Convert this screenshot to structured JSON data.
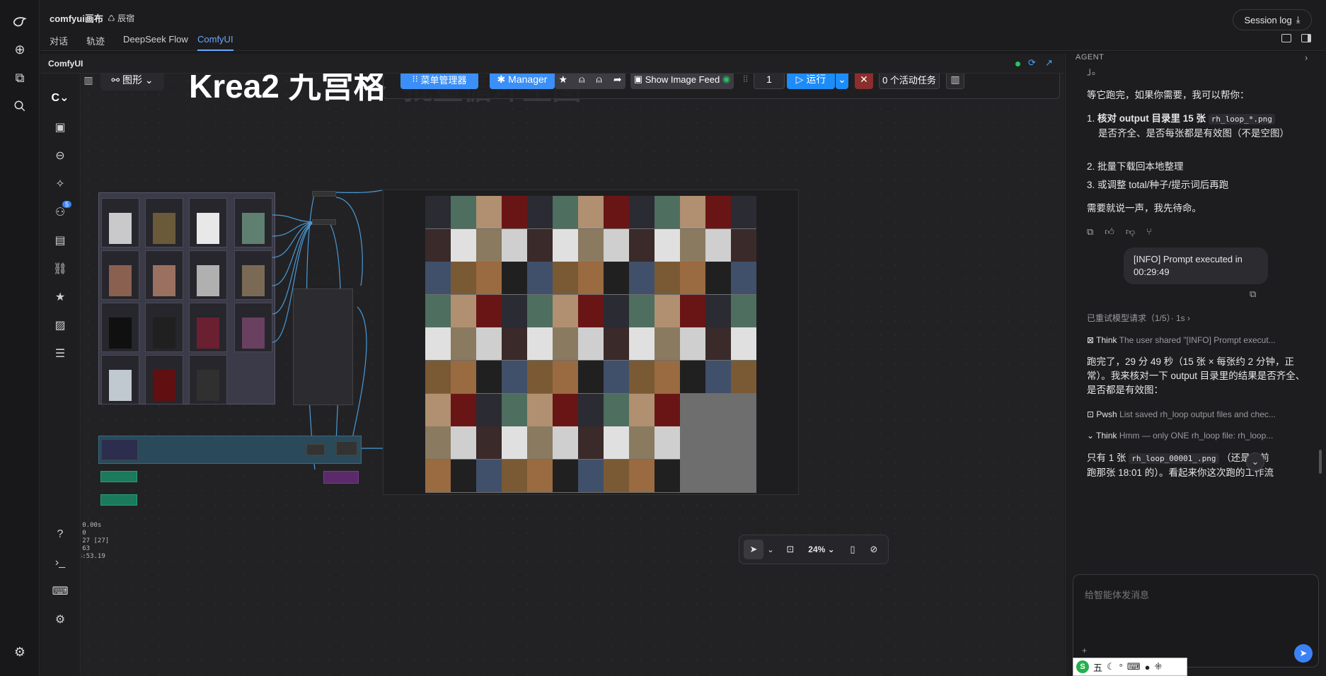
{
  "window": {
    "title": "comfyui画布",
    "workspace": "辰宿"
  },
  "tabs": [
    {
      "label": "对话"
    },
    {
      "label": "轨迹"
    },
    {
      "label": "DeepSeek Flow"
    },
    {
      "label": "ComfyUI"
    }
  ],
  "session_log": {
    "label": "Session log"
  },
  "panel": {
    "title": "ComfyUI"
  },
  "sidebar": {
    "badge": "5"
  },
  "toolbar": {
    "graph_label": "图形",
    "workflow_title": "Krea2 九宫格",
    "menu_manager": "菜单管理器",
    "manager": "Manager",
    "image_feed": "Show Image Feed",
    "batch_count": "1",
    "run": "运行",
    "active_tasks": "0 个活动任务",
    "overlay_title": "批量循环生图"
  },
  "stats": {
    "t": "T: 0.00s",
    "i": "I: 0",
    "n": "N: 27 [27]",
    "v": "V: 63",
    "fps": "FPS:53.19"
  },
  "canvas_controls": {
    "zoom": "24%"
  },
  "agent": {
    "header": "AGENT",
    "fragment": "」。",
    "intro": "等它跑完，如果你需要，我可以帮你：",
    "items": [
      {
        "bold": "核对 output 目录里 15 张",
        "code": "rh_loop_*.png",
        "rest": "是否齐全、是否每张都是有效图（不是空图）"
      },
      {
        "text": "批量下载回本地整理"
      },
      {
        "text": "或调整 total/种子/提示词后再跑"
      }
    ],
    "closing": "需要就说一声，我先待命。",
    "user_msg": "[INFO] Prompt executed in 00:29:49",
    "retry": "已重试模型请求（1/5）· 1s",
    "think1_label": "Think",
    "think1_text": "The user shared \"[INFO] Prompt execut...",
    "reply": "跑完了，29 分 49 秒（15 张 × 每张约 2 分钟，正常）。我来核对一下 output 目录里的结果是否齐全、是否都是有效图：",
    "pwsh_label": "Pwsh",
    "pwsh_text": "List saved rh_loop output files and chec...",
    "think2_label": "Think",
    "think2_text": "Hmm — only ONE rh_loop file: rh_loop...",
    "last_prefix": "只有 1 张",
    "last_code": "rh_loop_00001_.png",
    "last_suffix": "（还是之前",
    "last_line2": "跑那张 18:01 的）。看起来你这次跑的工作流",
    "input_placeholder": "给智能体发消息"
  },
  "ime": {
    "label": "五"
  },
  "colors": {
    "accent": "#3b82f6",
    "run": "#1d8cf8",
    "stop": "#8b2e2e",
    "active_tab": "#6aa7ff"
  }
}
